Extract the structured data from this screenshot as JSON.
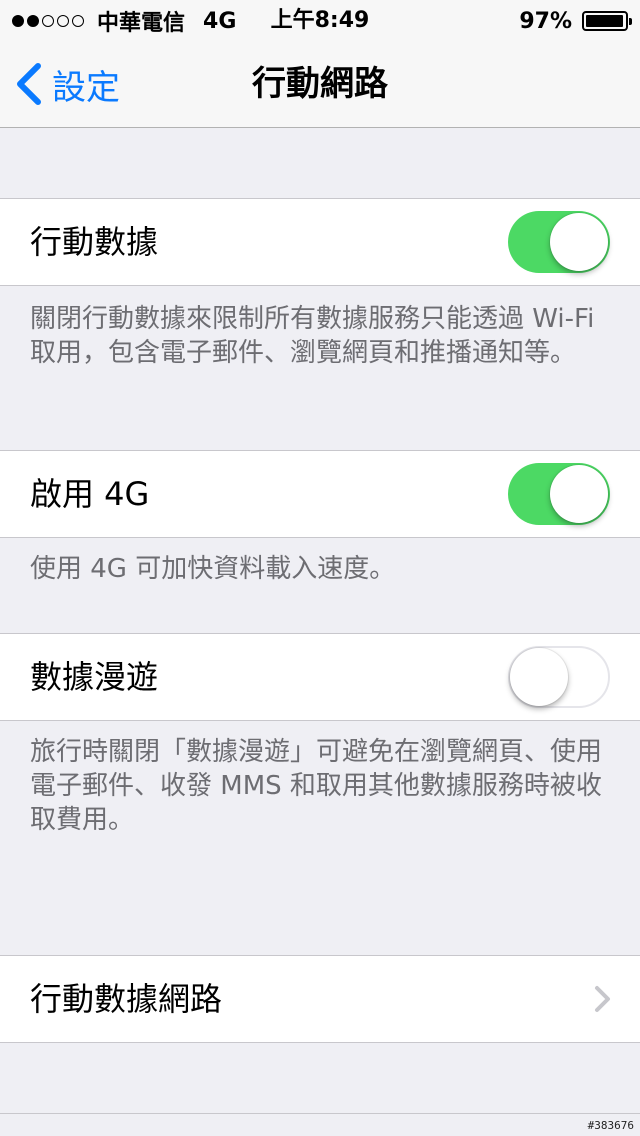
{
  "status_bar": {
    "signal_bars_filled": 2,
    "signal_bars_total": 5,
    "carrier": "中華電信",
    "network": "4G",
    "time": "上午8:49",
    "battery_text": "97%",
    "battery_level": 0.97
  },
  "nav": {
    "back_label": "設定",
    "title": "行動網路"
  },
  "cells": {
    "cellular_data": {
      "label": "行動數據",
      "on": true
    },
    "enable_4g": {
      "label": "啟用 4G",
      "on": true
    },
    "data_roaming": {
      "label": "數據漫遊",
      "on": false
    },
    "cellular_data_network": {
      "label": "行動數據網路"
    }
  },
  "notes": {
    "cellular_data": "關閉行動數據來限制所有數據服務只能透過 Wi-Fi 取用，包含電子郵件、瀏覽網頁和推播通知等。",
    "enable_4g": "使用 4G 可加快資料載入速度。",
    "data_roaming": "旅行時關閉「數據漫遊」可避免在瀏覽網頁、使用電子郵件、收發 MMS 和取用其他數據服務時被收取費用。"
  },
  "colors": {
    "accent": "#0a7aff",
    "toggle_on": "#4cd964",
    "background": "#efeff4"
  },
  "watermark": "#383676"
}
